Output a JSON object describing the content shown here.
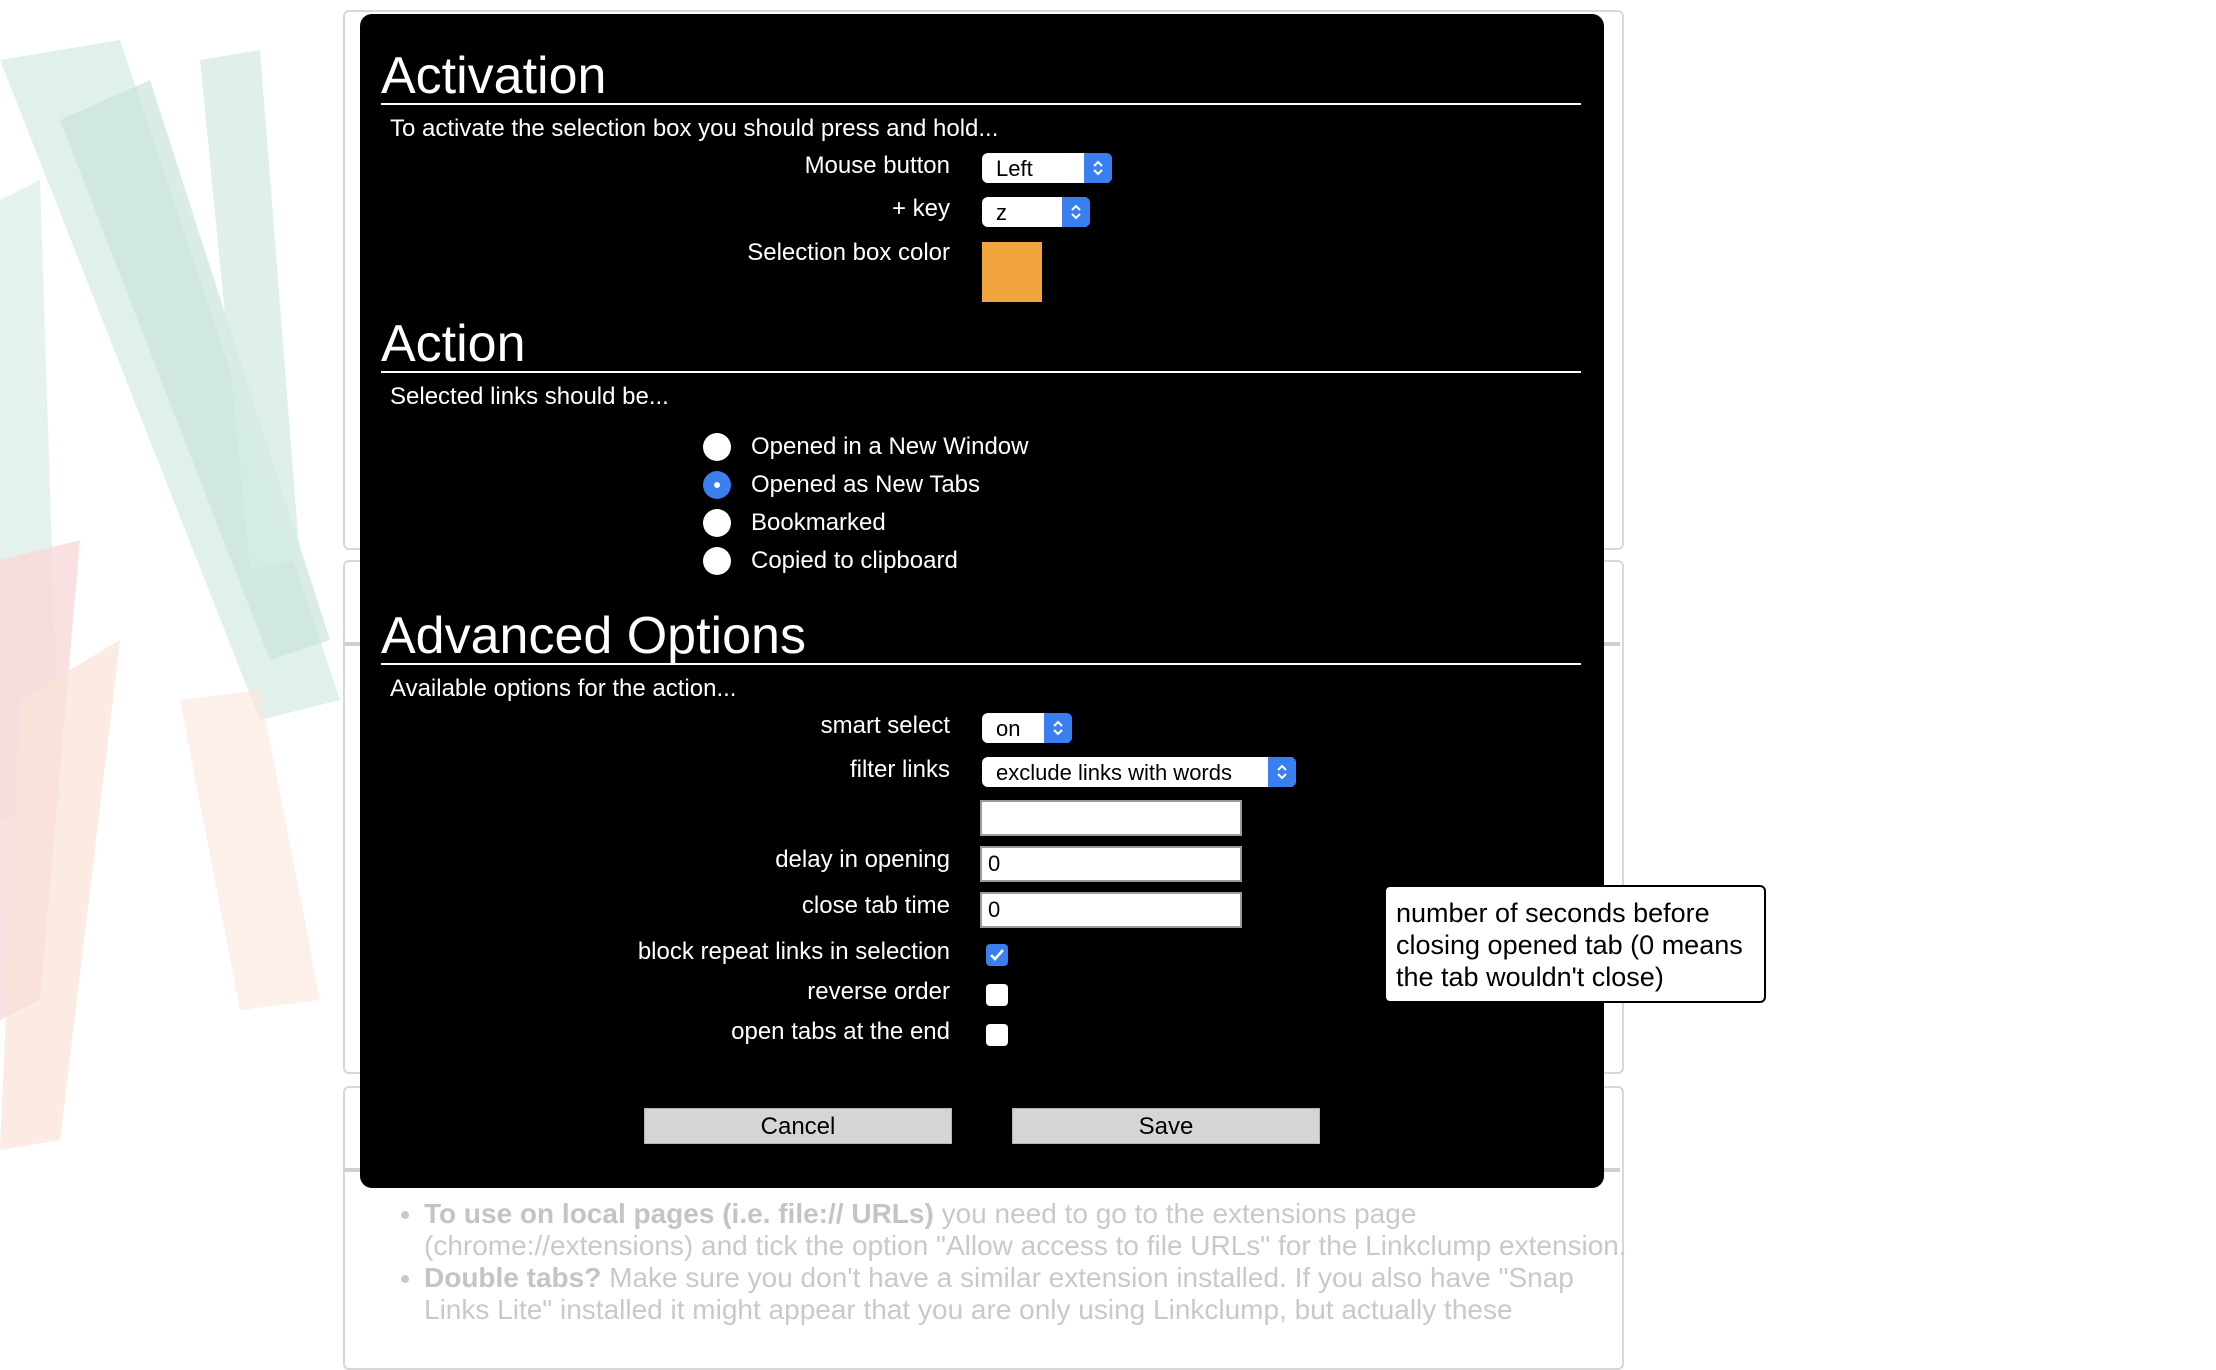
{
  "activation": {
    "title": "Activation",
    "intro": "To activate the selection box you should press and hold...",
    "mouse_button_label": "Mouse button",
    "mouse_button_value": "Left",
    "key_label": "+ key",
    "key_value": "z",
    "color_label": "Selection box color",
    "color_value": "#f2a53d"
  },
  "action": {
    "title": "Action",
    "intro": "Selected links should be...",
    "options": [
      {
        "label": "Opened in a New Window",
        "selected": false
      },
      {
        "label": "Opened as New Tabs",
        "selected": true
      },
      {
        "label": "Bookmarked",
        "selected": false
      },
      {
        "label": "Copied to clipboard",
        "selected": false
      }
    ]
  },
  "advanced": {
    "title": "Advanced Options",
    "intro": "Available options for the action...",
    "smart_select_label": "smart select",
    "smart_select_value": "on",
    "filter_links_label": "filter links",
    "filter_links_value": "exclude links with words",
    "filter_words_value": "",
    "delay_label": "delay in opening",
    "delay_value": "0",
    "close_tab_label": "close tab time",
    "close_tab_value": "0",
    "block_repeat_label": "block repeat links in selection",
    "block_repeat_checked": true,
    "reverse_order_label": "reverse order",
    "reverse_order_checked": false,
    "open_end_label": "open tabs at the end",
    "open_end_checked": false
  },
  "buttons": {
    "cancel": "Cancel",
    "save": "Save"
  },
  "tooltip": "number of seconds before closing opened tab (0 means the tab wouldn't close)",
  "background_notes": [
    {
      "bold": "To use on local pages (i.e. file:// URLs)",
      "text": " you need to go to the extensions page (chrome://extensions) and tick the option \"Allow access to file URLs\" for the Linkclump extension."
    },
    {
      "bold": "Double tabs?",
      "text": " Make sure you don't have a similar extension installed. If you also have \"Snap Links Lite\" installed it might appear that you are only using Linkclump, but actually these"
    }
  ],
  "colors": {
    "accent": "#3a7ff0",
    "dialog_bg": "#000000"
  }
}
